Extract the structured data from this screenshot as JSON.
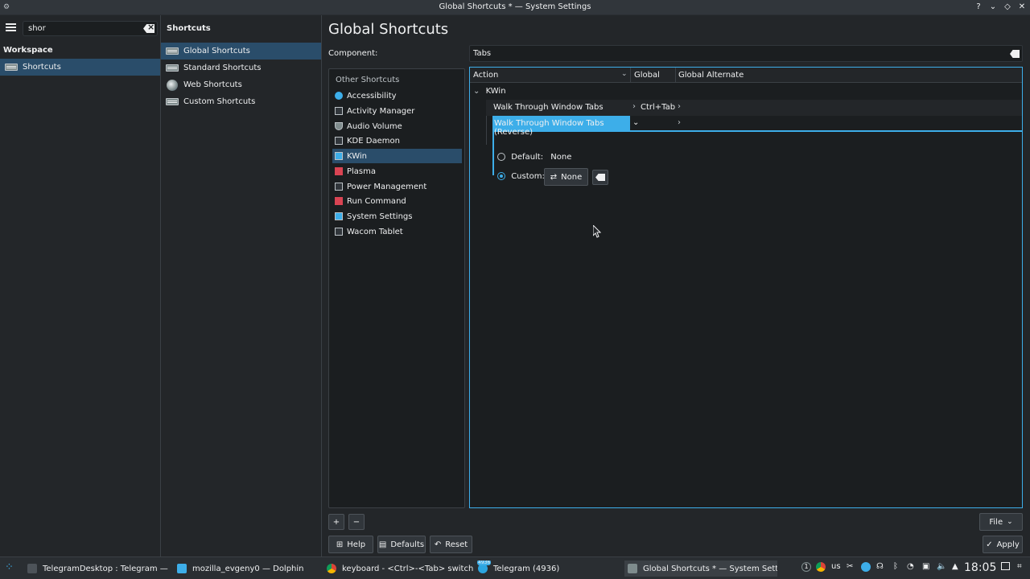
{
  "window": {
    "title": "Global Shortcuts * — System Settings",
    "buttons": [
      "?",
      "⌄",
      "◇",
      "✕"
    ]
  },
  "sidebar": {
    "search_value": "shor",
    "category": "Workspace",
    "item": "Shortcuts"
  },
  "subnav": {
    "header": "Shortcuts",
    "items": [
      {
        "label": "Global Shortcuts"
      },
      {
        "label": "Standard Shortcuts"
      },
      {
        "label": "Web Shortcuts"
      },
      {
        "label": "Custom Shortcuts"
      }
    ]
  },
  "main": {
    "title": "Global Shortcuts",
    "component_label": "Component:",
    "component_value": "Tabs",
    "components_header": "Other Shortcuts",
    "components": [
      {
        "label": "Accessibility",
        "icon": "accessibility-icon"
      },
      {
        "label": "Activity Manager",
        "icon": "app-icon"
      },
      {
        "label": "Audio Volume",
        "icon": "audio-icon"
      },
      {
        "label": "KDE Daemon",
        "icon": "app-icon"
      },
      {
        "label": "KWin",
        "icon": "kwin-icon"
      },
      {
        "label": "Plasma",
        "icon": "plasma-icon"
      },
      {
        "label": "Power Management",
        "icon": "app-icon"
      },
      {
        "label": "Run Command",
        "icon": "run-icon"
      },
      {
        "label": "System Settings",
        "icon": "settings-icon"
      },
      {
        "label": "Wacom Tablet",
        "icon": "app-icon"
      }
    ],
    "table": {
      "col_action": "Action",
      "col_global": "Global",
      "col_global_alt": "Global Alternate",
      "group": "KWin",
      "row1_action": "Walk Through Window Tabs",
      "row1_global": "Ctrl+Tab",
      "row2_action": "Walk Through Window Tabs (Reverse)",
      "default_label": "Default:",
      "default_value": "None",
      "custom_label": "Custom:",
      "custom_value": "None"
    },
    "footer": {
      "add": "+",
      "remove": "−",
      "file": "File",
      "help": "Help",
      "defaults": "Defaults",
      "reset": "Reset",
      "apply": "Apply"
    }
  },
  "taskbar": {
    "tasks": [
      {
        "label": "TelegramDesktop : Telegram — Ko..."
      },
      {
        "label": "mozilla_evgeny0 — Dolphin"
      },
      {
        "label": "keyboard - <Ctrl>-<Tab> switch bet..."
      },
      {
        "label": "Telegram (4936)"
      },
      {
        "label": "Global Shortcuts * — System Settin..."
      }
    ],
    "badge": "4936",
    "tray_notification_count": "1",
    "keyboard_layout": "us",
    "clock": "18:05"
  },
  "colors": {
    "accent": "#3daee9",
    "selection": "#2a4d6a",
    "background": "#232629",
    "view": "#1b1e20"
  }
}
